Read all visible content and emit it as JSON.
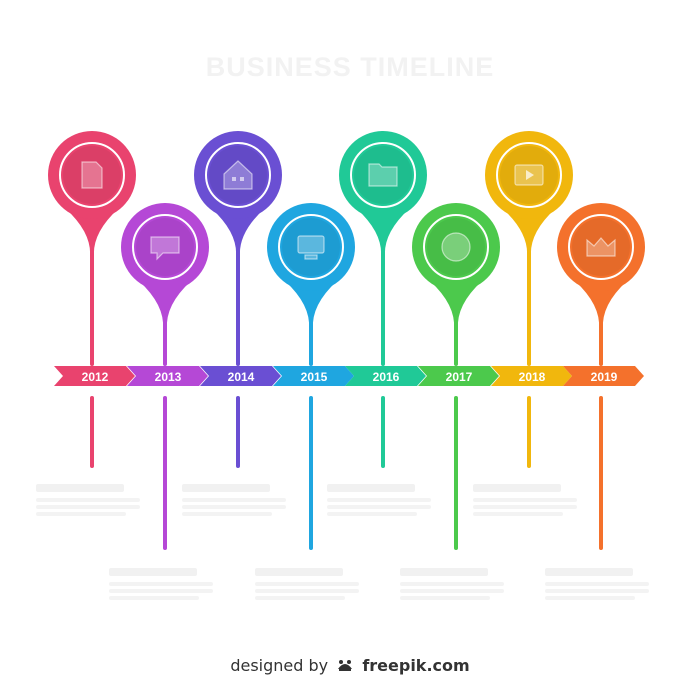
{
  "title": "BUSINESS TIMELINE",
  "years": [
    {
      "label": "2012",
      "color": "#e9436e",
      "icon": "document-icon",
      "pin": "high",
      "text_block": "low-left"
    },
    {
      "label": "2013",
      "color": "#b548d6",
      "icon": "chat-bubble-icon",
      "pin": "low",
      "text_block": "low-right"
    },
    {
      "label": "2014",
      "color": "#6a4fd3",
      "icon": "house-icon",
      "pin": "high",
      "text_block": "low-left"
    },
    {
      "label": "2015",
      "color": "#1fa6e0",
      "icon": "monitor-icon",
      "pin": "low",
      "text_block": "low-right"
    },
    {
      "label": "2016",
      "color": "#20c997",
      "icon": "folder-icon",
      "pin": "high",
      "text_block": "low-left"
    },
    {
      "label": "2017",
      "color": "#4cc94c",
      "icon": "globe-icon",
      "pin": "low",
      "text_block": "low-right"
    },
    {
      "label": "2018",
      "color": "#f1b70d",
      "icon": "play-video-icon",
      "pin": "high",
      "text_block": "low-left"
    },
    {
      "label": "2019",
      "color": "#f4712c",
      "icon": "crown-icon",
      "pin": "low",
      "text_block": "low-right"
    }
  ],
  "watermark": {
    "prefix": "designed by",
    "brand": "freepik.com",
    "logo_icon": "freepik-logo-icon"
  }
}
